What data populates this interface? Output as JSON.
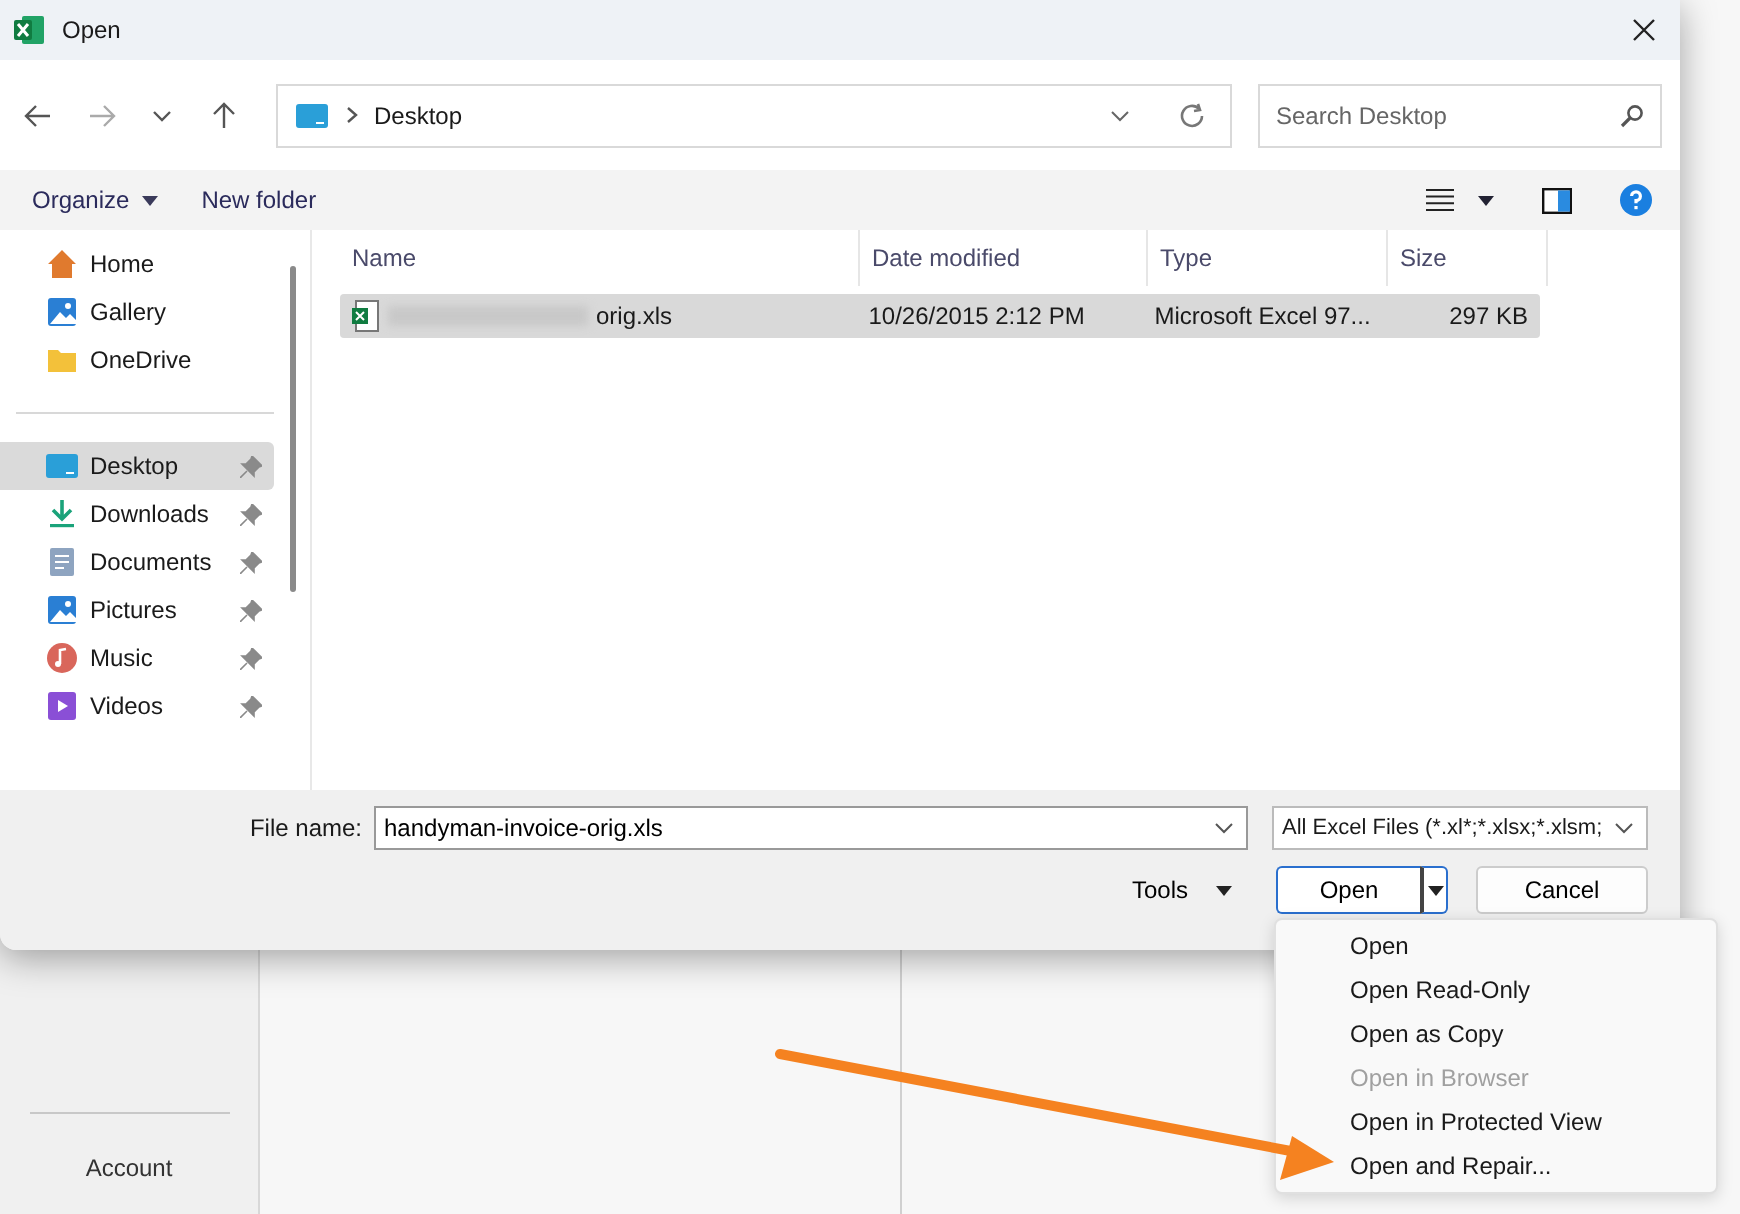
{
  "window": {
    "title": "Open"
  },
  "address": {
    "path": "Desktop"
  },
  "search": {
    "placeholder": "Search Desktop"
  },
  "toolbar": {
    "organize": "Organize",
    "new_folder": "New folder"
  },
  "sidebar": {
    "groups": [
      {
        "items": [
          {
            "label": "Home",
            "selected": false,
            "pinned": false
          },
          {
            "label": "Gallery",
            "selected": false,
            "pinned": false
          },
          {
            "label": "OneDrive",
            "selected": false,
            "pinned": false
          }
        ]
      },
      {
        "items": [
          {
            "label": "Desktop",
            "selected": true,
            "pinned": true
          },
          {
            "label": "Downloads",
            "selected": false,
            "pinned": true
          },
          {
            "label": "Documents",
            "selected": false,
            "pinned": true
          },
          {
            "label": "Pictures",
            "selected": false,
            "pinned": true
          },
          {
            "label": "Music",
            "selected": false,
            "pinned": true
          },
          {
            "label": "Videos",
            "selected": false,
            "pinned": true
          }
        ]
      }
    ]
  },
  "columns": [
    "Name",
    "Date modified",
    "Type",
    "Size"
  ],
  "files": [
    {
      "name": "orig.xls",
      "date": "10/26/2015 2:12 PM",
      "type": "Microsoft Excel 97...",
      "size": "297 KB",
      "selected": true
    }
  ],
  "file_name": {
    "label": "File name:",
    "value": "handyman-invoice-orig.xls"
  },
  "file_type": {
    "value": "All Excel Files (*.xl*;*.xlsx;*.xlsm;"
  },
  "tools": "Tools",
  "buttons": {
    "open": "Open",
    "cancel": "Cancel"
  },
  "open_menu": [
    {
      "label": "Open",
      "disabled": false
    },
    {
      "label": "Open Read-Only",
      "disabled": false
    },
    {
      "label": "Open as Copy",
      "disabled": false
    },
    {
      "label": "Open in Browser",
      "disabled": true
    },
    {
      "label": "Open in Protected View",
      "disabled": false
    },
    {
      "label": "Open and Repair...",
      "disabled": false
    }
  ],
  "background": {
    "account": "Account"
  }
}
